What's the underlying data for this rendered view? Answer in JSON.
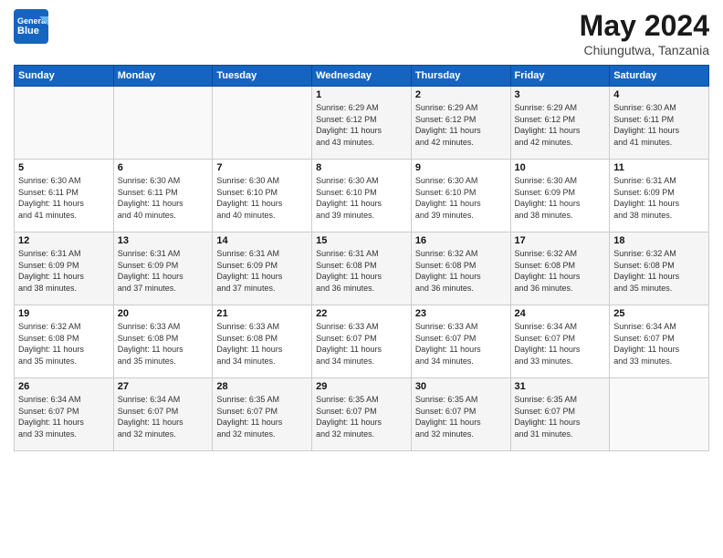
{
  "header": {
    "logo_general": "General",
    "logo_blue": "Blue",
    "month": "May 2024",
    "location": "Chiungutwa, Tanzania"
  },
  "weekdays": [
    "Sunday",
    "Monday",
    "Tuesday",
    "Wednesday",
    "Thursday",
    "Friday",
    "Saturday"
  ],
  "weeks": [
    [
      {
        "day": "",
        "detail": ""
      },
      {
        "day": "",
        "detail": ""
      },
      {
        "day": "",
        "detail": ""
      },
      {
        "day": "1",
        "detail": "Sunrise: 6:29 AM\nSunset: 6:12 PM\nDaylight: 11 hours\nand 43 minutes."
      },
      {
        "day": "2",
        "detail": "Sunrise: 6:29 AM\nSunset: 6:12 PM\nDaylight: 11 hours\nand 42 minutes."
      },
      {
        "day": "3",
        "detail": "Sunrise: 6:29 AM\nSunset: 6:12 PM\nDaylight: 11 hours\nand 42 minutes."
      },
      {
        "day": "4",
        "detail": "Sunrise: 6:30 AM\nSunset: 6:11 PM\nDaylight: 11 hours\nand 41 minutes."
      }
    ],
    [
      {
        "day": "5",
        "detail": "Sunrise: 6:30 AM\nSunset: 6:11 PM\nDaylight: 11 hours\nand 41 minutes."
      },
      {
        "day": "6",
        "detail": "Sunrise: 6:30 AM\nSunset: 6:11 PM\nDaylight: 11 hours\nand 40 minutes."
      },
      {
        "day": "7",
        "detail": "Sunrise: 6:30 AM\nSunset: 6:10 PM\nDaylight: 11 hours\nand 40 minutes."
      },
      {
        "day": "8",
        "detail": "Sunrise: 6:30 AM\nSunset: 6:10 PM\nDaylight: 11 hours\nand 39 minutes."
      },
      {
        "day": "9",
        "detail": "Sunrise: 6:30 AM\nSunset: 6:10 PM\nDaylight: 11 hours\nand 39 minutes."
      },
      {
        "day": "10",
        "detail": "Sunrise: 6:30 AM\nSunset: 6:09 PM\nDaylight: 11 hours\nand 38 minutes."
      },
      {
        "day": "11",
        "detail": "Sunrise: 6:31 AM\nSunset: 6:09 PM\nDaylight: 11 hours\nand 38 minutes."
      }
    ],
    [
      {
        "day": "12",
        "detail": "Sunrise: 6:31 AM\nSunset: 6:09 PM\nDaylight: 11 hours\nand 38 minutes."
      },
      {
        "day": "13",
        "detail": "Sunrise: 6:31 AM\nSunset: 6:09 PM\nDaylight: 11 hours\nand 37 minutes."
      },
      {
        "day": "14",
        "detail": "Sunrise: 6:31 AM\nSunset: 6:09 PM\nDaylight: 11 hours\nand 37 minutes."
      },
      {
        "day": "15",
        "detail": "Sunrise: 6:31 AM\nSunset: 6:08 PM\nDaylight: 11 hours\nand 36 minutes."
      },
      {
        "day": "16",
        "detail": "Sunrise: 6:32 AM\nSunset: 6:08 PM\nDaylight: 11 hours\nand 36 minutes."
      },
      {
        "day": "17",
        "detail": "Sunrise: 6:32 AM\nSunset: 6:08 PM\nDaylight: 11 hours\nand 36 minutes."
      },
      {
        "day": "18",
        "detail": "Sunrise: 6:32 AM\nSunset: 6:08 PM\nDaylight: 11 hours\nand 35 minutes."
      }
    ],
    [
      {
        "day": "19",
        "detail": "Sunrise: 6:32 AM\nSunset: 6:08 PM\nDaylight: 11 hours\nand 35 minutes."
      },
      {
        "day": "20",
        "detail": "Sunrise: 6:33 AM\nSunset: 6:08 PM\nDaylight: 11 hours\nand 35 minutes."
      },
      {
        "day": "21",
        "detail": "Sunrise: 6:33 AM\nSunset: 6:08 PM\nDaylight: 11 hours\nand 34 minutes."
      },
      {
        "day": "22",
        "detail": "Sunrise: 6:33 AM\nSunset: 6:07 PM\nDaylight: 11 hours\nand 34 minutes."
      },
      {
        "day": "23",
        "detail": "Sunrise: 6:33 AM\nSunset: 6:07 PM\nDaylight: 11 hours\nand 34 minutes."
      },
      {
        "day": "24",
        "detail": "Sunrise: 6:34 AM\nSunset: 6:07 PM\nDaylight: 11 hours\nand 33 minutes."
      },
      {
        "day": "25",
        "detail": "Sunrise: 6:34 AM\nSunset: 6:07 PM\nDaylight: 11 hours\nand 33 minutes."
      }
    ],
    [
      {
        "day": "26",
        "detail": "Sunrise: 6:34 AM\nSunset: 6:07 PM\nDaylight: 11 hours\nand 33 minutes."
      },
      {
        "day": "27",
        "detail": "Sunrise: 6:34 AM\nSunset: 6:07 PM\nDaylight: 11 hours\nand 32 minutes."
      },
      {
        "day": "28",
        "detail": "Sunrise: 6:35 AM\nSunset: 6:07 PM\nDaylight: 11 hours\nand 32 minutes."
      },
      {
        "day": "29",
        "detail": "Sunrise: 6:35 AM\nSunset: 6:07 PM\nDaylight: 11 hours\nand 32 minutes."
      },
      {
        "day": "30",
        "detail": "Sunrise: 6:35 AM\nSunset: 6:07 PM\nDaylight: 11 hours\nand 32 minutes."
      },
      {
        "day": "31",
        "detail": "Sunrise: 6:35 AM\nSunset: 6:07 PM\nDaylight: 11 hours\nand 31 minutes."
      },
      {
        "day": "",
        "detail": ""
      }
    ]
  ]
}
